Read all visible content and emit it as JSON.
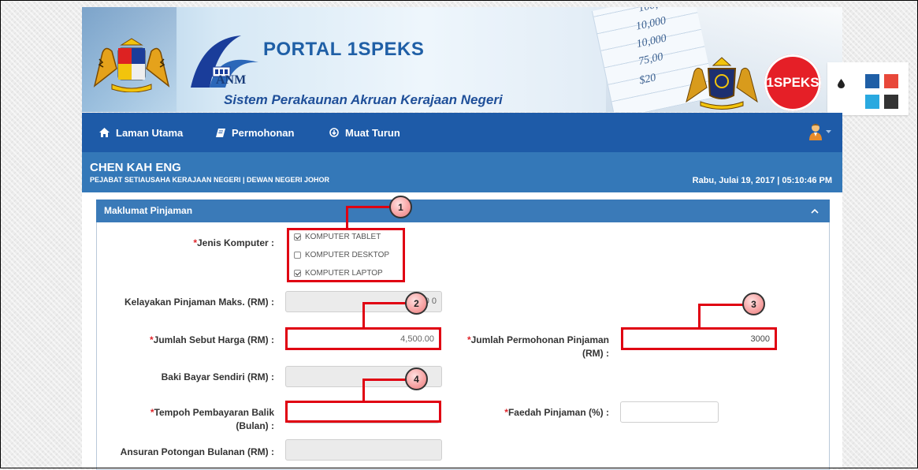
{
  "header": {
    "portal_title": "PORTAL 1SPEKS",
    "subtitle": "Sistem Perakaunan Akruan Kerajaan Negeri",
    "anm_logo_text": "ANM",
    "badge_text": "1SPEKS",
    "sheet_numbers": [
      "100,0",
      "10,000",
      "10,000",
      "75,00",
      "$20"
    ]
  },
  "theme_widget": {
    "icon": "droplet-icon",
    "swatches": [
      "#1f5fa6",
      "#e8483a",
      "#2aa9e0",
      "#333333"
    ]
  },
  "nav": {
    "items": [
      {
        "label": "Laman Utama",
        "icon": "home-icon"
      },
      {
        "label": "Permohonan",
        "icon": "book-icon"
      },
      {
        "label": "Muat Turun",
        "icon": "download-circle-icon"
      }
    ],
    "user_icon": "user-avatar-icon"
  },
  "userbar": {
    "name": "CHEN KAH ENG",
    "department": "PEJABAT SETIAUSAHA KERAJAAN NEGERI | DEWAN NEGERI JOHOR",
    "datetime": "Rabu, Julai 19, 2017 | 05:10:46 PM"
  },
  "panel": {
    "title": "Maklumat Pinjaman",
    "collapse_icon": "chevron-up-icon"
  },
  "form": {
    "jenis_komputer": {
      "label": "Jenis Komputer :",
      "options": [
        {
          "label": "KOMPUTER TABLET",
          "checked": true
        },
        {
          "label": "KOMPUTER DESKTOP",
          "checked": false
        },
        {
          "label": "KOMPUTER LAPTOP",
          "checked": true
        }
      ]
    },
    "kelayakan": {
      "label": "Kelayakan Pinjaman Maks. (RM) :",
      "value": "5,0  0"
    },
    "sebut_harga": {
      "label": "Jumlah Sebut Harga (RM) :",
      "value": "4,500.00"
    },
    "permohonan": {
      "label_line1": "Jumlah Permohonan Pinjaman",
      "label_line2": "(RM) :",
      "value": "3000"
    },
    "baki": {
      "label": "Baki Bayar Sendiri (RM) :",
      "value": ""
    },
    "tempoh": {
      "label_line1": "Tempoh Pembayaran Balik",
      "label_line2": "(Bulan) :",
      "value": ""
    },
    "faedah": {
      "label": "Faedah Pinjaman (%) :",
      "value": ""
    },
    "ansuran": {
      "label": "Ansuran Potongan Bulanan (RM) :",
      "value": ""
    }
  },
  "annotations": [
    "1",
    "2",
    "3",
    "4"
  ],
  "colors": {
    "navbar": "#1e5ba8",
    "infobar": "#3478b8",
    "panel_header": "#3a7ab8",
    "annotation_red": "#e00012",
    "required": "#e0262c"
  }
}
